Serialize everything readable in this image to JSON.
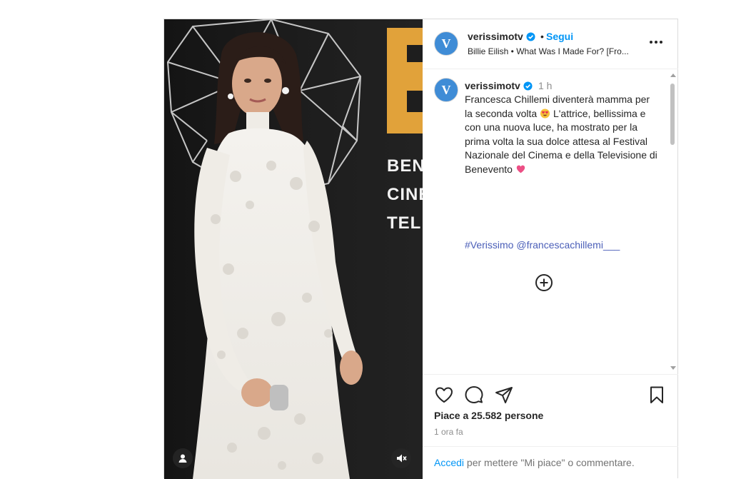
{
  "post": {
    "author": {
      "username": "verissimotv",
      "avatar_letter": "V",
      "follow_label": "Segui",
      "separator": "•",
      "audio": "Billie Eilish • What Was I Made For? [Fro..."
    },
    "caption": {
      "username": "verissimotv",
      "time": "1 h",
      "text_part1": "Francesca Chillemi diventerà mamma per la seconda volta",
      "emoji1": "heart-eyes-emoji",
      "text_part2": " L'attrice, bellissima e con una nuova luce, ha mostrato per la prima volta la sua dolce attesa al Festival Nazionale del Cinema e della Televisione di Benevento",
      "emoji2": "pink-heart-emoji",
      "hashtag": "#Verissimo",
      "mention": "@francescachillemi___"
    },
    "likes": "Piace a 25.582 persone",
    "time_ago": "1 ora fa",
    "login_link": "Accedi",
    "login_text": " per mettere \"Mi piace\" o commentare."
  },
  "media": {
    "sign_lines": [
      "BEN",
      "CINE",
      "TELI"
    ],
    "brand_letter": "B"
  },
  "icons": {
    "more": "more-options-icon",
    "verified": "verified-badge-icon",
    "load_more": "plus-circle-icon",
    "like": "heart-icon",
    "comment": "comment-icon",
    "share": "share-icon",
    "save": "bookmark-icon",
    "user_tag": "user-icon",
    "mute": "speaker-muted-icon"
  },
  "colors": {
    "link_blue": "#0095f6",
    "hashtag_blue": "#4a5eb8",
    "avatar_blue": "#3f8cd6",
    "sign_orange": "#e1a23a"
  }
}
